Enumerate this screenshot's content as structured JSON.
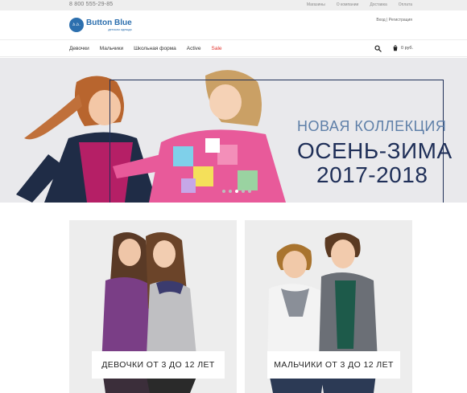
{
  "topbar": {
    "phone": "8 800 555-29-85",
    "links": [
      "Магазины",
      "О компании",
      "Доставка",
      "Оплата"
    ]
  },
  "header": {
    "logo": {
      "title": "Button Blue",
      "subtitle": "детская одежда",
      "mark": "b.b."
    },
    "auth": "Вход | Регистрация"
  },
  "nav": {
    "items": [
      "Девочки",
      "Мальчики",
      "Школьная форма",
      "Active",
      "Sale"
    ],
    "cart_amount": "0 руб.",
    "sale_color": "#e2322c"
  },
  "hero": {
    "line1": "НОВАЯ КОЛЛЕКЦИЯ",
    "line2": "ОСЕНЬ-ЗИМА",
    "line3": "2017-2018",
    "slide_count": 5,
    "active_slide": 2
  },
  "categories": [
    {
      "label": "ДЕВОЧКИ ОТ 3 ДО 12 ЛЕТ"
    },
    {
      "label": "МАЛЬЧИКИ ОТ 3 ДО 12 ЛЕТ"
    }
  ],
  "colors": {
    "brand": "#2c6fae",
    "navy": "#1f2f58",
    "accent_light": "#5e7fa8"
  }
}
